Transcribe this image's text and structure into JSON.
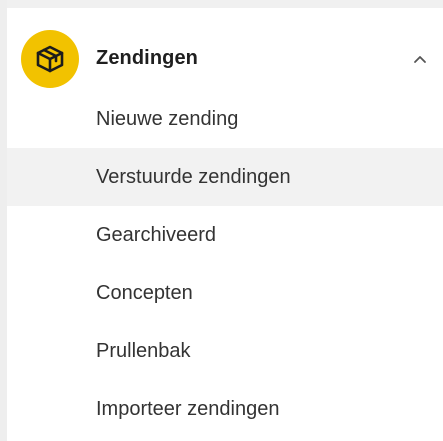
{
  "nav": {
    "group": {
      "title": "Zendingen",
      "icon": "package-icon",
      "expand_icon": "chevron-up-icon",
      "accent_color": "#f2c200"
    },
    "items": [
      {
        "label": "Nieuwe zending"
      },
      {
        "label": "Verstuurde zendingen",
        "active": true
      },
      {
        "label": "Gearchiveerd"
      },
      {
        "label": "Concepten"
      },
      {
        "label": "Prullenbak"
      },
      {
        "label": "Importeer zendingen"
      }
    ]
  }
}
